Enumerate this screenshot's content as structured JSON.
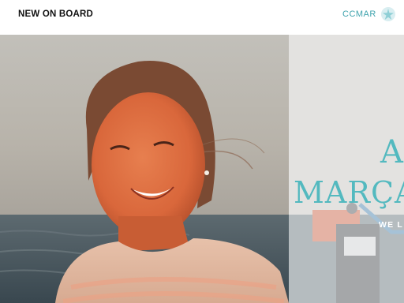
{
  "header": {
    "title": "NEW ON BOARD",
    "logo_text": "CCMAR",
    "logo_icon": "starfish-logo-icon"
  },
  "hero": {
    "name_first": "A",
    "name_last": "MARÇA",
    "tagline": "WE L",
    "colors": {
      "accent": "#53b9bf",
      "overlay": "#ffffff",
      "sky": "#b8b5ad",
      "sea": "#475860"
    }
  }
}
